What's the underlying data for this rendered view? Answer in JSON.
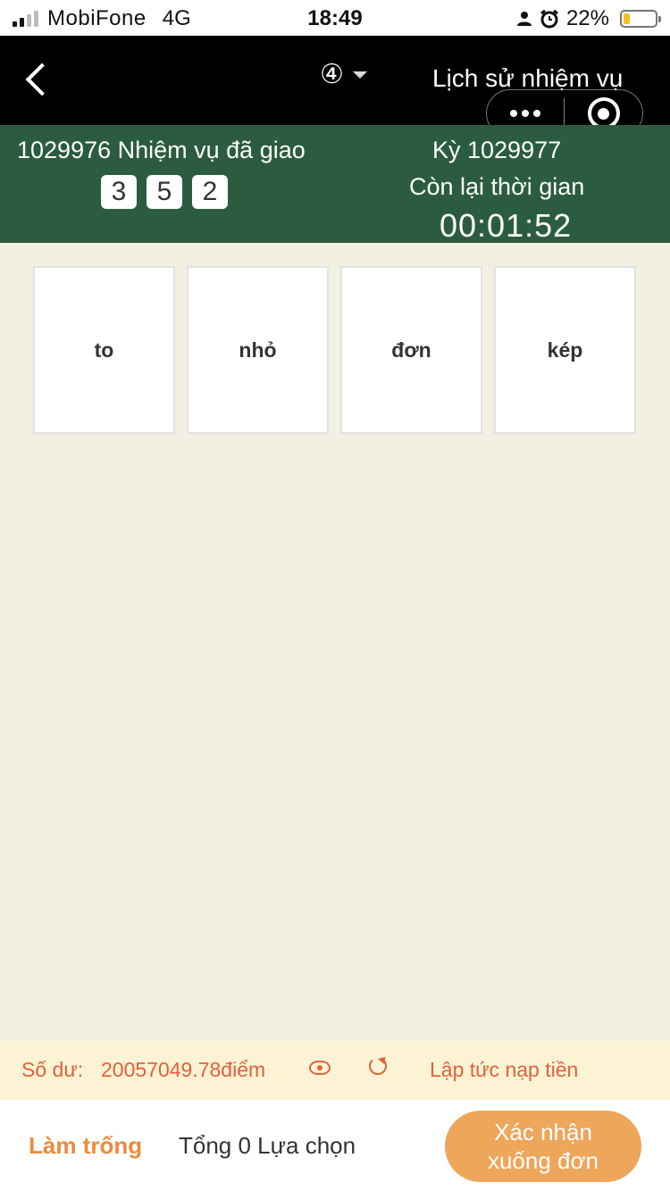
{
  "status_bar": {
    "carrier": "MobiFone",
    "network": "4G",
    "time": "18:49",
    "battery": "22%",
    "battery_level": 0.22,
    "signal_bars_active": 2,
    "signal_bars_total": 4
  },
  "nav": {
    "lottery_selector": "④",
    "history_link": "Lịch sử nhiệm vụ"
  },
  "info": {
    "previous_title": "1029976 Nhiệm vụ đã giao",
    "previous_result": [
      "3",
      "5",
      "2"
    ],
    "period_label": "Kỳ 1029977",
    "remaining_label": "Còn lại thời gian",
    "countdown": "00:01:52"
  },
  "options": [
    "to",
    "nhỏ",
    "đơn",
    "kép"
  ],
  "balance": {
    "label": "Số dư:",
    "value": "20057049.78điểm",
    "topup": "Lập tức nạp tiền"
  },
  "bottom": {
    "clear": "Làm trống",
    "total": "Tổng 0 Lựa chọn",
    "confirm_line1": "Xác nhận",
    "confirm_line2": "xuống đơn"
  },
  "colors": {
    "header_green": "#2c5c3f",
    "accent_orange": "#eda65a",
    "balance_text": "#e2613b",
    "page_bg": "#f2f0e3"
  }
}
